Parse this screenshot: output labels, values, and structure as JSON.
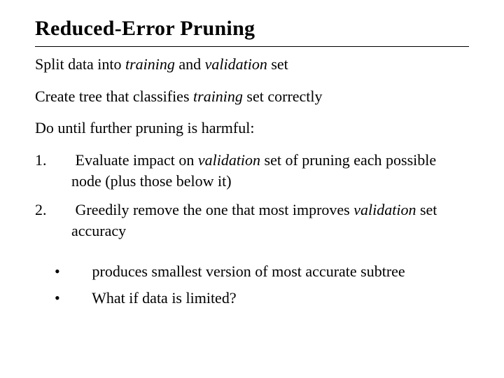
{
  "title": "Reduced-Error Pruning",
  "p1": {
    "a": "Split data into ",
    "b": "training",
    "c": " and ",
    "d": "validation",
    "e": " set"
  },
  "p2": {
    "a": "Create tree that classifies ",
    "b": "training",
    "c": " set correctly"
  },
  "p3": "Do until further pruning is harmful:",
  "item1": {
    "num": "1.",
    "a": " Evaluate impact on ",
    "b": "validation",
    "c": " set of pruning each possible node (plus those below it)"
  },
  "item2": {
    "num": "2.",
    "a": " Greedily remove the one that most improves ",
    "b": "validation",
    "c": " set accuracy"
  },
  "bullet_char": "•",
  "b1": " produces smallest version of most accurate subtree",
  "b2": " What if data is limited?"
}
